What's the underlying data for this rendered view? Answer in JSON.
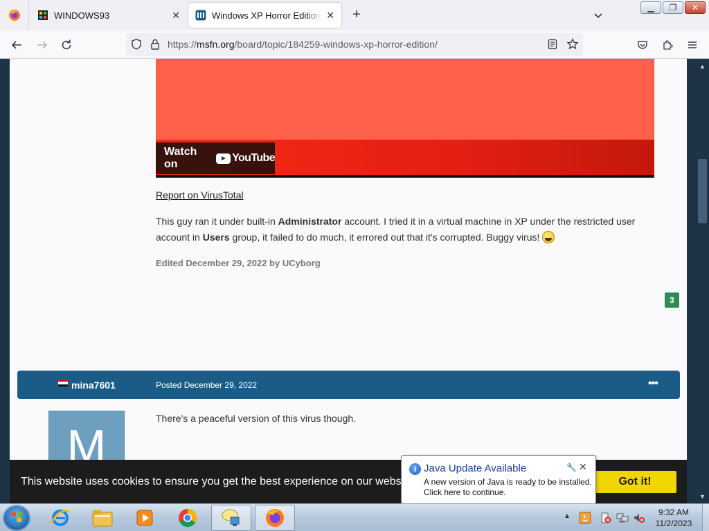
{
  "browser": {
    "tabs": [
      {
        "label": "WINDOWS93",
        "favicon": "windows93-favicon"
      },
      {
        "label": "Windows XP Horror Edition - MSFN",
        "favicon": "msfn-favicon",
        "active": true
      }
    ],
    "url_prefix": "https://",
    "url_domain": "msfn.org",
    "url_path": "/board/topic/184259-windows-xp-horror-edition/"
  },
  "post": {
    "video": {
      "watch_on": "Watch on",
      "platform": "YouTube"
    },
    "report_link": "Report on VirusTotal",
    "body": {
      "t1": "This guy ran it under built-in ",
      "b1": "Administrator",
      "t2": " account. I tried it in a virtual machine in XP under the restricted user account in ",
      "b2": "Users",
      "t3": " group, it failed to do much, it errored out that it's corrupted. Buggy virus! "
    },
    "edited": "Edited December 29, 2022 by UCyborg",
    "reputation": "3"
  },
  "reply": {
    "username": "mina7601",
    "posted_label": "Posted",
    "posted_date": "December 29, 2022",
    "more": "•••",
    "avatar_letter": "M",
    "text": "There's a peaceful version of this virus though."
  },
  "cookie": {
    "text": "This website uses cookies to ensure you get the best experience on our website.",
    "button": "Got it!"
  },
  "notification": {
    "title": "Java Update Available",
    "body": "A new version of Java is ready to be installed. Click here to continue."
  },
  "taskbar": {
    "time": "9:32 AM",
    "date": "11/2/2023"
  },
  "colors": {
    "post_header": "#1b5c86",
    "cookie_button": "#f1d600",
    "reputation_badge": "#2e8b57"
  }
}
